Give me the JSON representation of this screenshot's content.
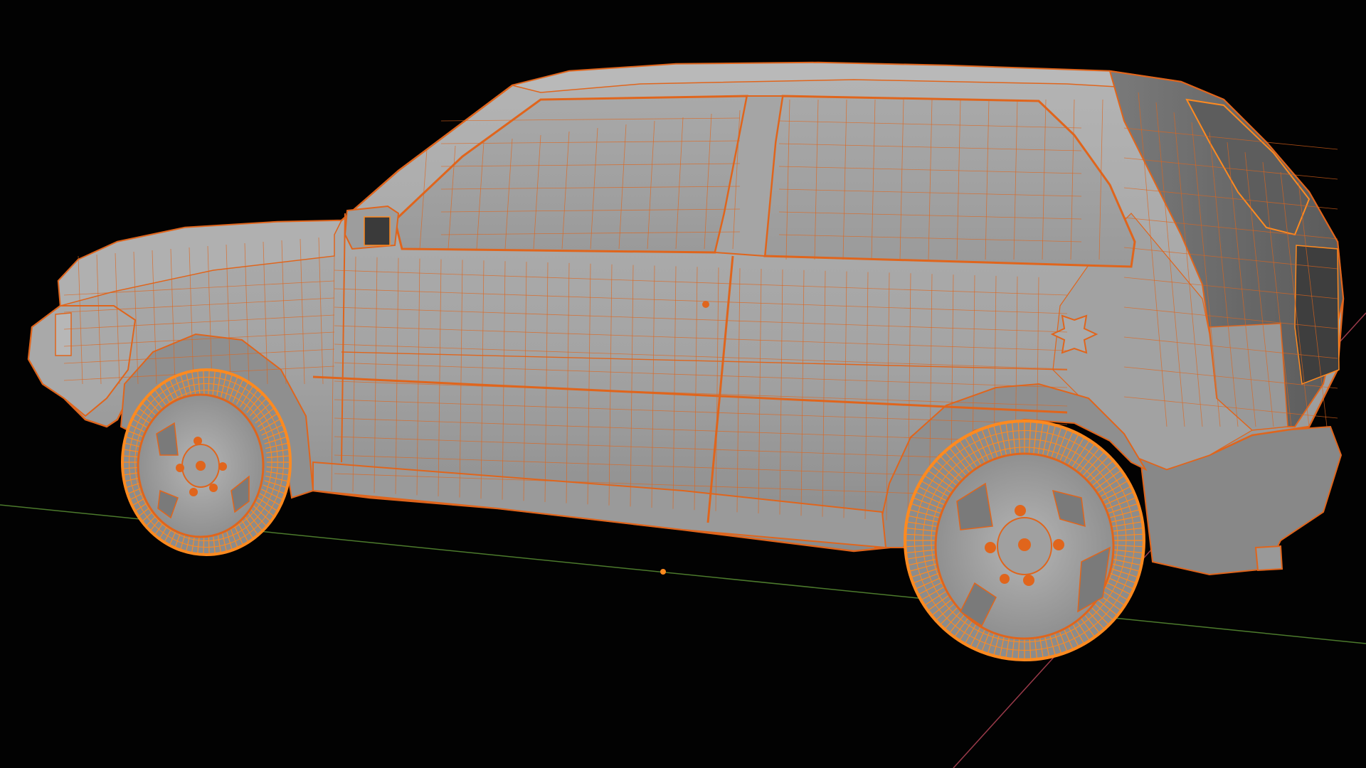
{
  "viewport": {
    "mode": "3d-viewport",
    "shading": "solid-with-wireframe-overlay",
    "selection": "car-model"
  },
  "colors": {
    "background": "#020202",
    "body": "#a8a8a8",
    "body_shadow": "#7d7d7d",
    "glass": "#9c9c9c",
    "wire": "#e0651c",
    "wire_selected": "#ff8a1f",
    "axis_x": "#9a3a4a",
    "axis_y": "#4c7a2c",
    "origin": "#ff8a1f"
  },
  "icons": {
    "origin": "object-origin-dot-icon",
    "gizmo": "floor-grid-axis-icon"
  }
}
